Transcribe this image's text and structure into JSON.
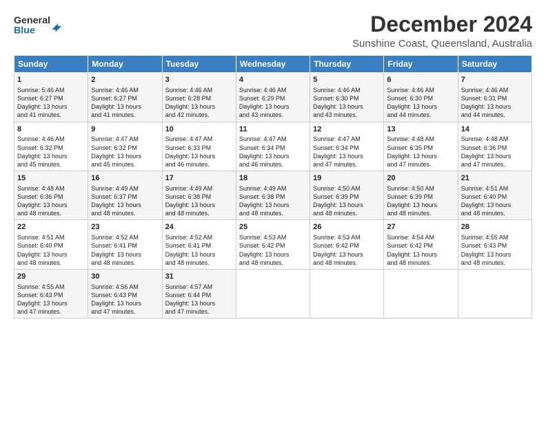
{
  "header": {
    "logo_line1": "General",
    "logo_line2": "Blue",
    "title": "December 2024",
    "subtitle": "Sunshine Coast, Queensland, Australia"
  },
  "days_header": [
    "Sunday",
    "Monday",
    "Tuesday",
    "Wednesday",
    "Thursday",
    "Friday",
    "Saturday"
  ],
  "weeks": [
    [
      {
        "day": "1",
        "sunrise": "5:46 AM",
        "sunset": "6:27 PM",
        "daylight": "13 hours and 41 minutes."
      },
      {
        "day": "2",
        "sunrise": "4:46 AM",
        "sunset": "6:27 PM",
        "daylight": "13 hours and 41 minutes."
      },
      {
        "day": "3",
        "sunrise": "4:46 AM",
        "sunset": "6:28 PM",
        "daylight": "13 hours and 42 minutes."
      },
      {
        "day": "4",
        "sunrise": "4:46 AM",
        "sunset": "6:29 PM",
        "daylight": "13 hours and 43 minutes."
      },
      {
        "day": "5",
        "sunrise": "4:46 AM",
        "sunset": "6:30 PM",
        "daylight": "13 hours and 43 minutes."
      },
      {
        "day": "6",
        "sunrise": "4:46 AM",
        "sunset": "6:30 PM",
        "daylight": "13 hours and 44 minutes."
      },
      {
        "day": "7",
        "sunrise": "4:46 AM",
        "sunset": "6:31 PM",
        "daylight": "13 hours and 44 minutes."
      }
    ],
    [
      {
        "day": "8",
        "sunrise": "4:46 AM",
        "sunset": "6:32 PM",
        "daylight": "13 hours and 45 minutes."
      },
      {
        "day": "9",
        "sunrise": "4:47 AM",
        "sunset": "6:32 PM",
        "daylight": "13 hours and 45 minutes."
      },
      {
        "day": "10",
        "sunrise": "4:47 AM",
        "sunset": "6:33 PM",
        "daylight": "13 hours and 46 minutes."
      },
      {
        "day": "11",
        "sunrise": "4:47 AM",
        "sunset": "6:34 PM",
        "daylight": "13 hours and 46 minutes."
      },
      {
        "day": "12",
        "sunrise": "4:47 AM",
        "sunset": "6:34 PM",
        "daylight": "13 hours and 47 minutes."
      },
      {
        "day": "13",
        "sunrise": "4:48 AM",
        "sunset": "6:35 PM",
        "daylight": "13 hours and 47 minutes."
      },
      {
        "day": "14",
        "sunrise": "4:48 AM",
        "sunset": "6:36 PM",
        "daylight": "13 hours and 47 minutes."
      }
    ],
    [
      {
        "day": "15",
        "sunrise": "4:48 AM",
        "sunset": "6:36 PM",
        "daylight": "13 hours and 48 minutes."
      },
      {
        "day": "16",
        "sunrise": "4:49 AM",
        "sunset": "6:37 PM",
        "daylight": "13 hours and 48 minutes."
      },
      {
        "day": "17",
        "sunrise": "4:49 AM",
        "sunset": "6:38 PM",
        "daylight": "13 hours and 48 minutes."
      },
      {
        "day": "18",
        "sunrise": "4:49 AM",
        "sunset": "6:38 PM",
        "daylight": "13 hours and 48 minutes."
      },
      {
        "day": "19",
        "sunrise": "4:50 AM",
        "sunset": "6:39 PM",
        "daylight": "13 hours and 48 minutes."
      },
      {
        "day": "20",
        "sunrise": "4:50 AM",
        "sunset": "6:39 PM",
        "daylight": "13 hours and 48 minutes."
      },
      {
        "day": "21",
        "sunrise": "4:51 AM",
        "sunset": "6:40 PM",
        "daylight": "13 hours and 48 minutes."
      }
    ],
    [
      {
        "day": "22",
        "sunrise": "4:51 AM",
        "sunset": "6:40 PM",
        "daylight": "13 hours and 48 minutes."
      },
      {
        "day": "23",
        "sunrise": "4:52 AM",
        "sunset": "6:41 PM",
        "daylight": "13 hours and 48 minutes."
      },
      {
        "day": "24",
        "sunrise": "4:52 AM",
        "sunset": "6:41 PM",
        "daylight": "13 hours and 48 minutes."
      },
      {
        "day": "25",
        "sunrise": "4:53 AM",
        "sunset": "6:42 PM",
        "daylight": "13 hours and 48 minutes."
      },
      {
        "day": "26",
        "sunrise": "4:53 AM",
        "sunset": "6:42 PM",
        "daylight": "13 hours and 48 minutes."
      },
      {
        "day": "27",
        "sunrise": "4:54 AM",
        "sunset": "6:42 PM",
        "daylight": "13 hours and 48 minutes."
      },
      {
        "day": "28",
        "sunrise": "4:55 AM",
        "sunset": "6:43 PM",
        "daylight": "13 hours and 48 minutes."
      }
    ],
    [
      {
        "day": "29",
        "sunrise": "4:55 AM",
        "sunset": "6:43 PM",
        "daylight": "13 hours and 47 minutes."
      },
      {
        "day": "30",
        "sunrise": "4:56 AM",
        "sunset": "6:43 PM",
        "daylight": "13 hours and 47 minutes."
      },
      {
        "day": "31",
        "sunrise": "4:57 AM",
        "sunset": "6:44 PM",
        "daylight": "13 hours and 47 minutes."
      },
      null,
      null,
      null,
      null
    ]
  ],
  "labels": {
    "sunrise": "Sunrise:",
    "sunset": "Sunset:",
    "daylight": "Daylight:"
  }
}
